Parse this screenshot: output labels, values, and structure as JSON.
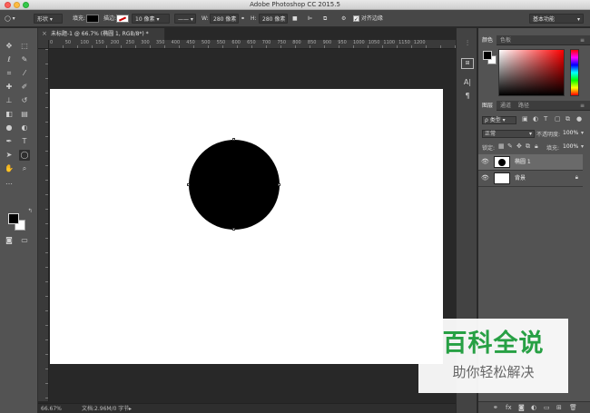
{
  "window": {
    "title": "Adobe Photoshop CC 2015.5"
  },
  "options_bar": {
    "mode": "形状",
    "fill_label": "填充:",
    "stroke_label": "描边:",
    "stroke_size": "10 像素",
    "w_label": "W:",
    "w_value": "280 像素",
    "h_label": "H:",
    "h_value": "280 像素",
    "align_edges_label": "对齐边缘",
    "workspace": "基本功能"
  },
  "document": {
    "tab_title": "未标题-1 @ 66.7% (椭圆 1, RGB/8*) *",
    "close_glyph": "×",
    "ruler_marks": [
      "0",
      "50",
      "100",
      "150",
      "200",
      "250",
      "300",
      "350",
      "400",
      "450",
      "500",
      "550",
      "600",
      "650",
      "700",
      "750",
      "800",
      "850",
      "900",
      "950",
      "1000",
      "1050",
      "1100",
      "1150",
      "1200"
    ]
  },
  "status": {
    "zoom": "66.67%",
    "doc_info": "文档:2.96M/0 字节"
  },
  "color_panel": {
    "tabs": [
      "颜色",
      "色板"
    ]
  },
  "layers_panel": {
    "tabs": [
      "图层",
      "通道",
      "路径"
    ],
    "filter": "ρ 类型",
    "blend_mode": "正常",
    "opacity_label": "不透明度:",
    "opacity": "100%",
    "lock_label": "锁定:",
    "fill_label": "填充:",
    "fill": "100%",
    "layers": [
      {
        "name": "椭圆 1",
        "selected": true
      },
      {
        "name": "背景",
        "selected": false,
        "locked": true
      }
    ]
  },
  "watermark": {
    "main": "百科全说",
    "sub": "助你轻松解决"
  },
  "colors": {
    "foreground": "#000000",
    "background": "#ffffff",
    "ellipse_fill": "#000000",
    "watermark_green": "#27a044"
  }
}
